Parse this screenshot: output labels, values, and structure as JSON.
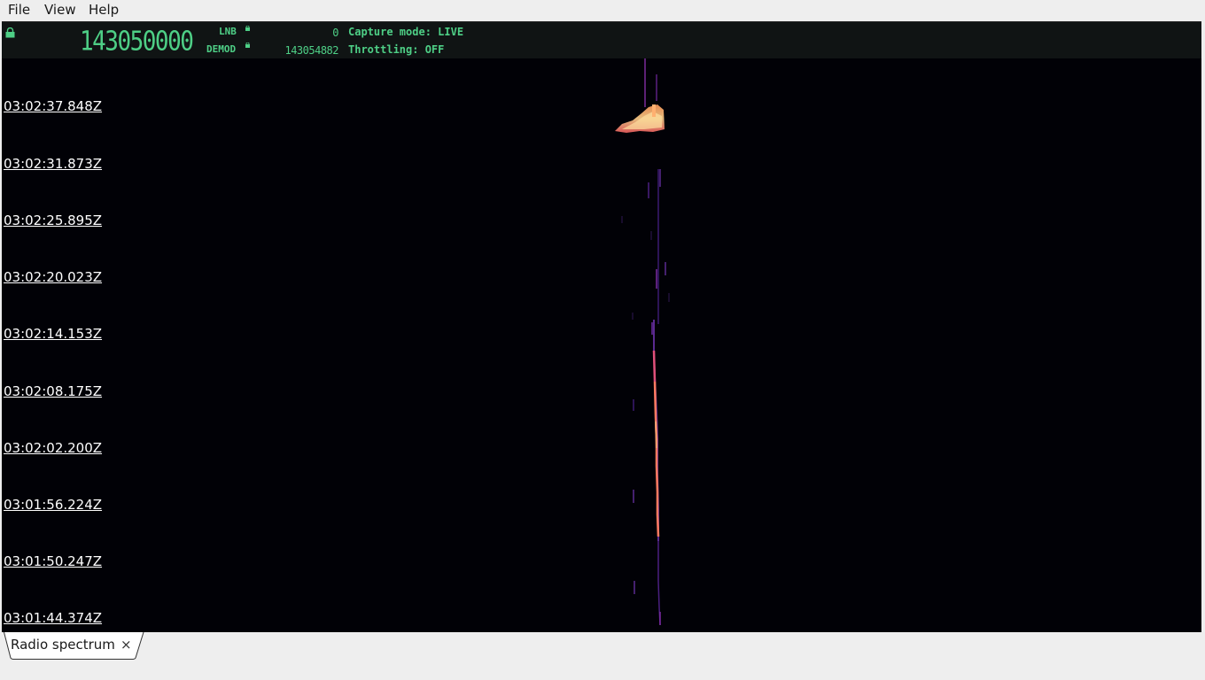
{
  "menu": {
    "file": "File",
    "view": "View",
    "help": "Help"
  },
  "header": {
    "main_frequency": "143050000",
    "lnb_label": "LNB",
    "lnb_value": "0",
    "demod_label": "DEMOD",
    "demod_value": "143054882",
    "capture_mode": "Capture mode: LIVE",
    "throttling": "Throttling: OFF",
    "text_color": "#4ecf86"
  },
  "waterfall": {
    "timestamps": [
      "03:02:37.848Z",
      "03:02:31.873Z",
      "03:02:25.895Z",
      "03:02:20.023Z",
      "03:02:14.153Z",
      "03:02:08.175Z",
      "03:02:02.200Z",
      "03:01:56.224Z",
      "03:01:50.247Z",
      "03:01:44.374Z"
    ],
    "background_color": "#010106"
  },
  "tabs": [
    {
      "label": "Radio spectrum",
      "close": "×"
    }
  ]
}
